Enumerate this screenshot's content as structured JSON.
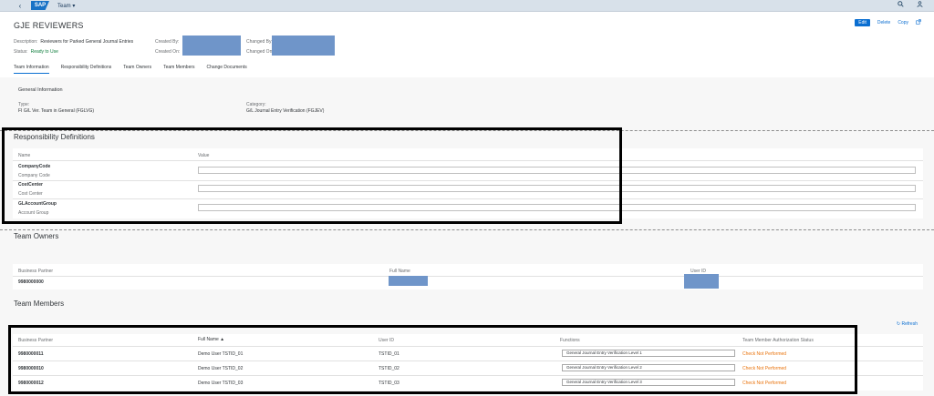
{
  "shell": {
    "back": "‹",
    "logo": "SAP",
    "app_title": "Team ▾",
    "search_icon": "search-icon",
    "user_icon": "user-icon"
  },
  "header": {
    "title": "GJE REVIEWERS",
    "actions": {
      "edit": "Edit",
      "delete": "Delete",
      "copy": "Copy"
    },
    "description_label": "Description:",
    "description_value": "Reviewers for Parked General Journal Entries",
    "status_label": "Status:",
    "status_value": "Ready to Use",
    "created_by_label": "Created By:",
    "created_on_label": "Created On:",
    "changed_by_label": "Changed By:",
    "changed_on_label": "Changed On:"
  },
  "tabs": [
    "Team Information",
    "Responsibility Definitions",
    "Team Owners",
    "Team Members",
    "Change Documents"
  ],
  "general_info": {
    "title": "General Information",
    "type_label": "Type:",
    "type_value": "FI G/L Ver. Team in General (FGLVG)",
    "category_label": "Category:",
    "category_value": "G/L Journal Entry Verification (FGJEV)"
  },
  "responsibility": {
    "title": "Responsibility Definitions",
    "col_name": "Name",
    "col_value": "Value",
    "rows": [
      {
        "name": "CompanyCode",
        "desc": "Company Code"
      },
      {
        "name": "CostCenter",
        "desc": "Cost Center"
      },
      {
        "name": "GLAccountGroup",
        "desc": "Account Group"
      }
    ]
  },
  "owners": {
    "title": "Team Owners",
    "col_bp": "Business Partner",
    "col_name": "Full Name",
    "col_user": "User ID",
    "row_bp": "9980000000"
  },
  "members": {
    "title": "Team Members",
    "refresh": "Refresh",
    "col_bp": "Business Partner",
    "col_name": "Full Name ▲",
    "col_user": "User ID",
    "col_func": "Functions",
    "col_status": "Team Member Authorization Status",
    "rows": [
      {
        "bp": "9980000011",
        "name": "Demo User TSTID_01",
        "user": "TSTID_01",
        "func": "General Journal Entry Verification Level 1",
        "status": "Check Not Performed"
      },
      {
        "bp": "9980000010",
        "name": "Demo User TSTID_02",
        "user": "TSTID_02",
        "func": "General Journal Entry Verification Level 2",
        "status": "Check Not Performed"
      },
      {
        "bp": "9980000012",
        "name": "Demo User TSTID_03",
        "user": "TSTID_03",
        "func": "General Journal Entry Verification Level 3",
        "status": "Check Not Performed"
      }
    ]
  },
  "colors": {
    "accent": "#0a6ed1",
    "success": "#107e3e",
    "warning": "#e9730c",
    "redaction": "#6f95c9"
  }
}
